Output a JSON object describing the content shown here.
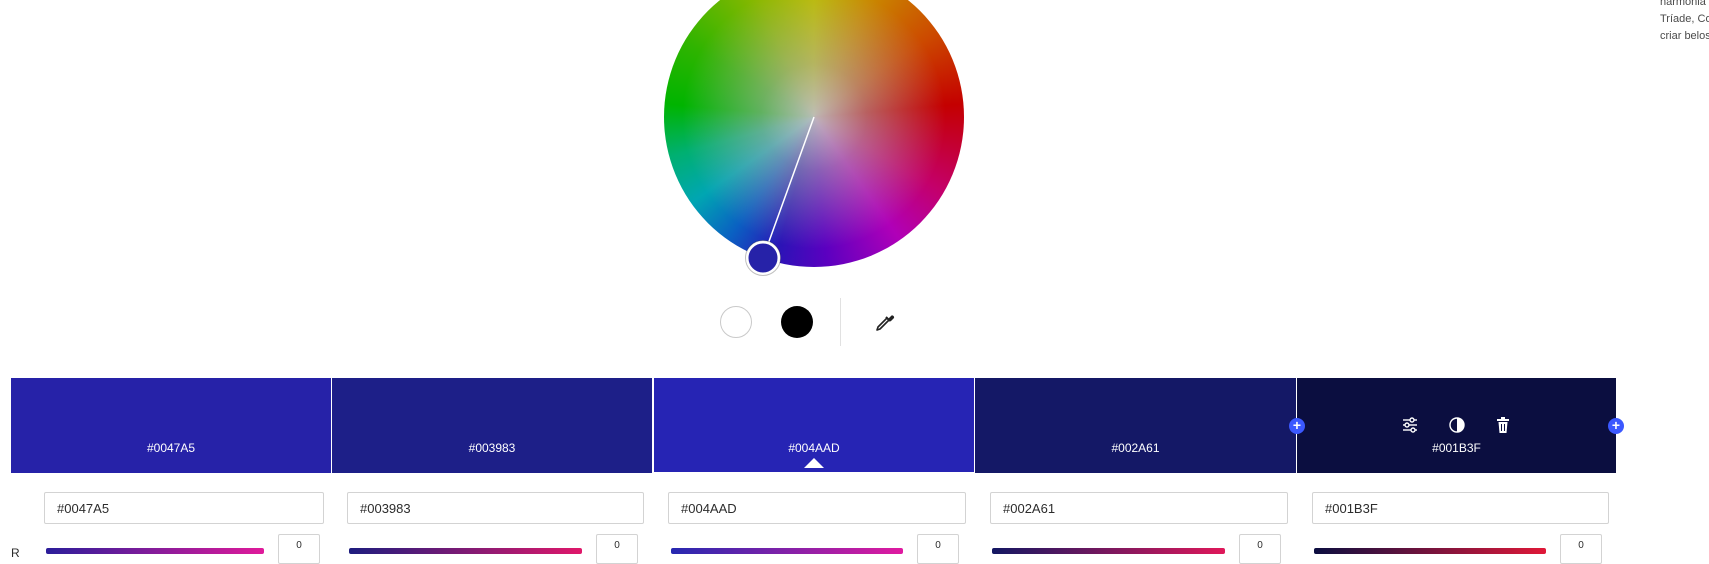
{
  "side_text": {
    "line1": "harmonia",
    "line2": "Tríade, Co",
    "line3": "criar belos"
  },
  "tools": {
    "white": "white-swatch",
    "black": "black-swatch",
    "eyedropper": "eyedropper-icon"
  },
  "swatches": [
    {
      "hex": "#0047A5",
      "color": "#2622a8"
    },
    {
      "hex": "#003983",
      "color": "#1d1f88"
    },
    {
      "hex": "#004AAD",
      "color": "#2624b4"
    },
    {
      "hex": "#002A61",
      "color": "#141866"
    },
    {
      "hex": "#001B3F",
      "color": "#0b0e40"
    }
  ],
  "inputs": [
    "#0047A5",
    "#003983",
    "#004AAD",
    "#002A61",
    "#001B3F"
  ],
  "sliders": {
    "row_label": "R",
    "values": [
      "0",
      "0",
      "0",
      "0",
      "0"
    ]
  },
  "colors": {
    "accent": "#3b58ff",
    "selected_handle": "#2622a8"
  }
}
